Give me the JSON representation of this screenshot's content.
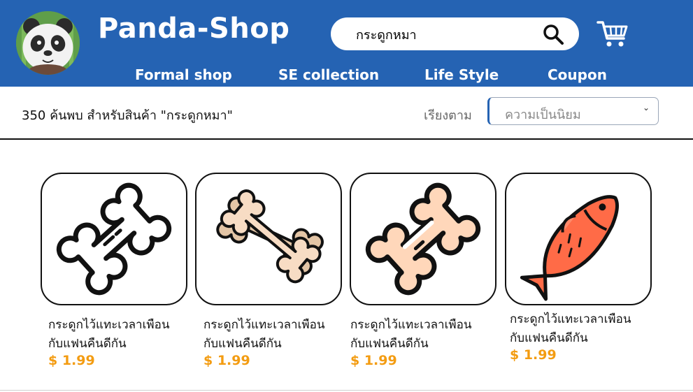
{
  "app": {
    "brand": "Panda-Shop",
    "colors": {
      "header": "#2563b3",
      "price": "#f39c12"
    }
  },
  "search": {
    "value": "กระดูกหมา",
    "icon": "search-icon"
  },
  "cart": {
    "icon": "shopping-cart-icon"
  },
  "nav": [
    {
      "label": "Formal shop"
    },
    {
      "label": "SE collection"
    },
    {
      "label": "Life Style"
    },
    {
      "label": "Coupon"
    }
  ],
  "results": {
    "summary": "350 ค้นพบ สำหรับสินค้า \"กระดูกหมา\""
  },
  "sort": {
    "label": "เรียงตาม",
    "selected": "ความเป็นนิยม"
  },
  "products": [
    {
      "name_line1": "กระดูกไว้แทะเวลาเพือน",
      "name_line2": "กับแฟนคืนดีกัน",
      "price": "$ 1.99",
      "icon": "bone-outline-icon"
    },
    {
      "name_line1": "กระดูกไว้แทะเวลาเพือน",
      "name_line2": "กับแฟนคืนดีกัน",
      "price": "$ 1.99",
      "icon": "crossed-bones-icon"
    },
    {
      "name_line1": "กระดูกไว้แทะเวลาเพือน",
      "name_line2": "กับแฟนคืนดีกัน",
      "price": "$ 1.99",
      "icon": "bone-icon"
    },
    {
      "name_line1": "กระดูกไว้แทะเวลาเพือน",
      "name_line2": "กับแฟนคืนดีกัน",
      "price": "$ 1.99",
      "icon": "fish-icon"
    }
  ]
}
